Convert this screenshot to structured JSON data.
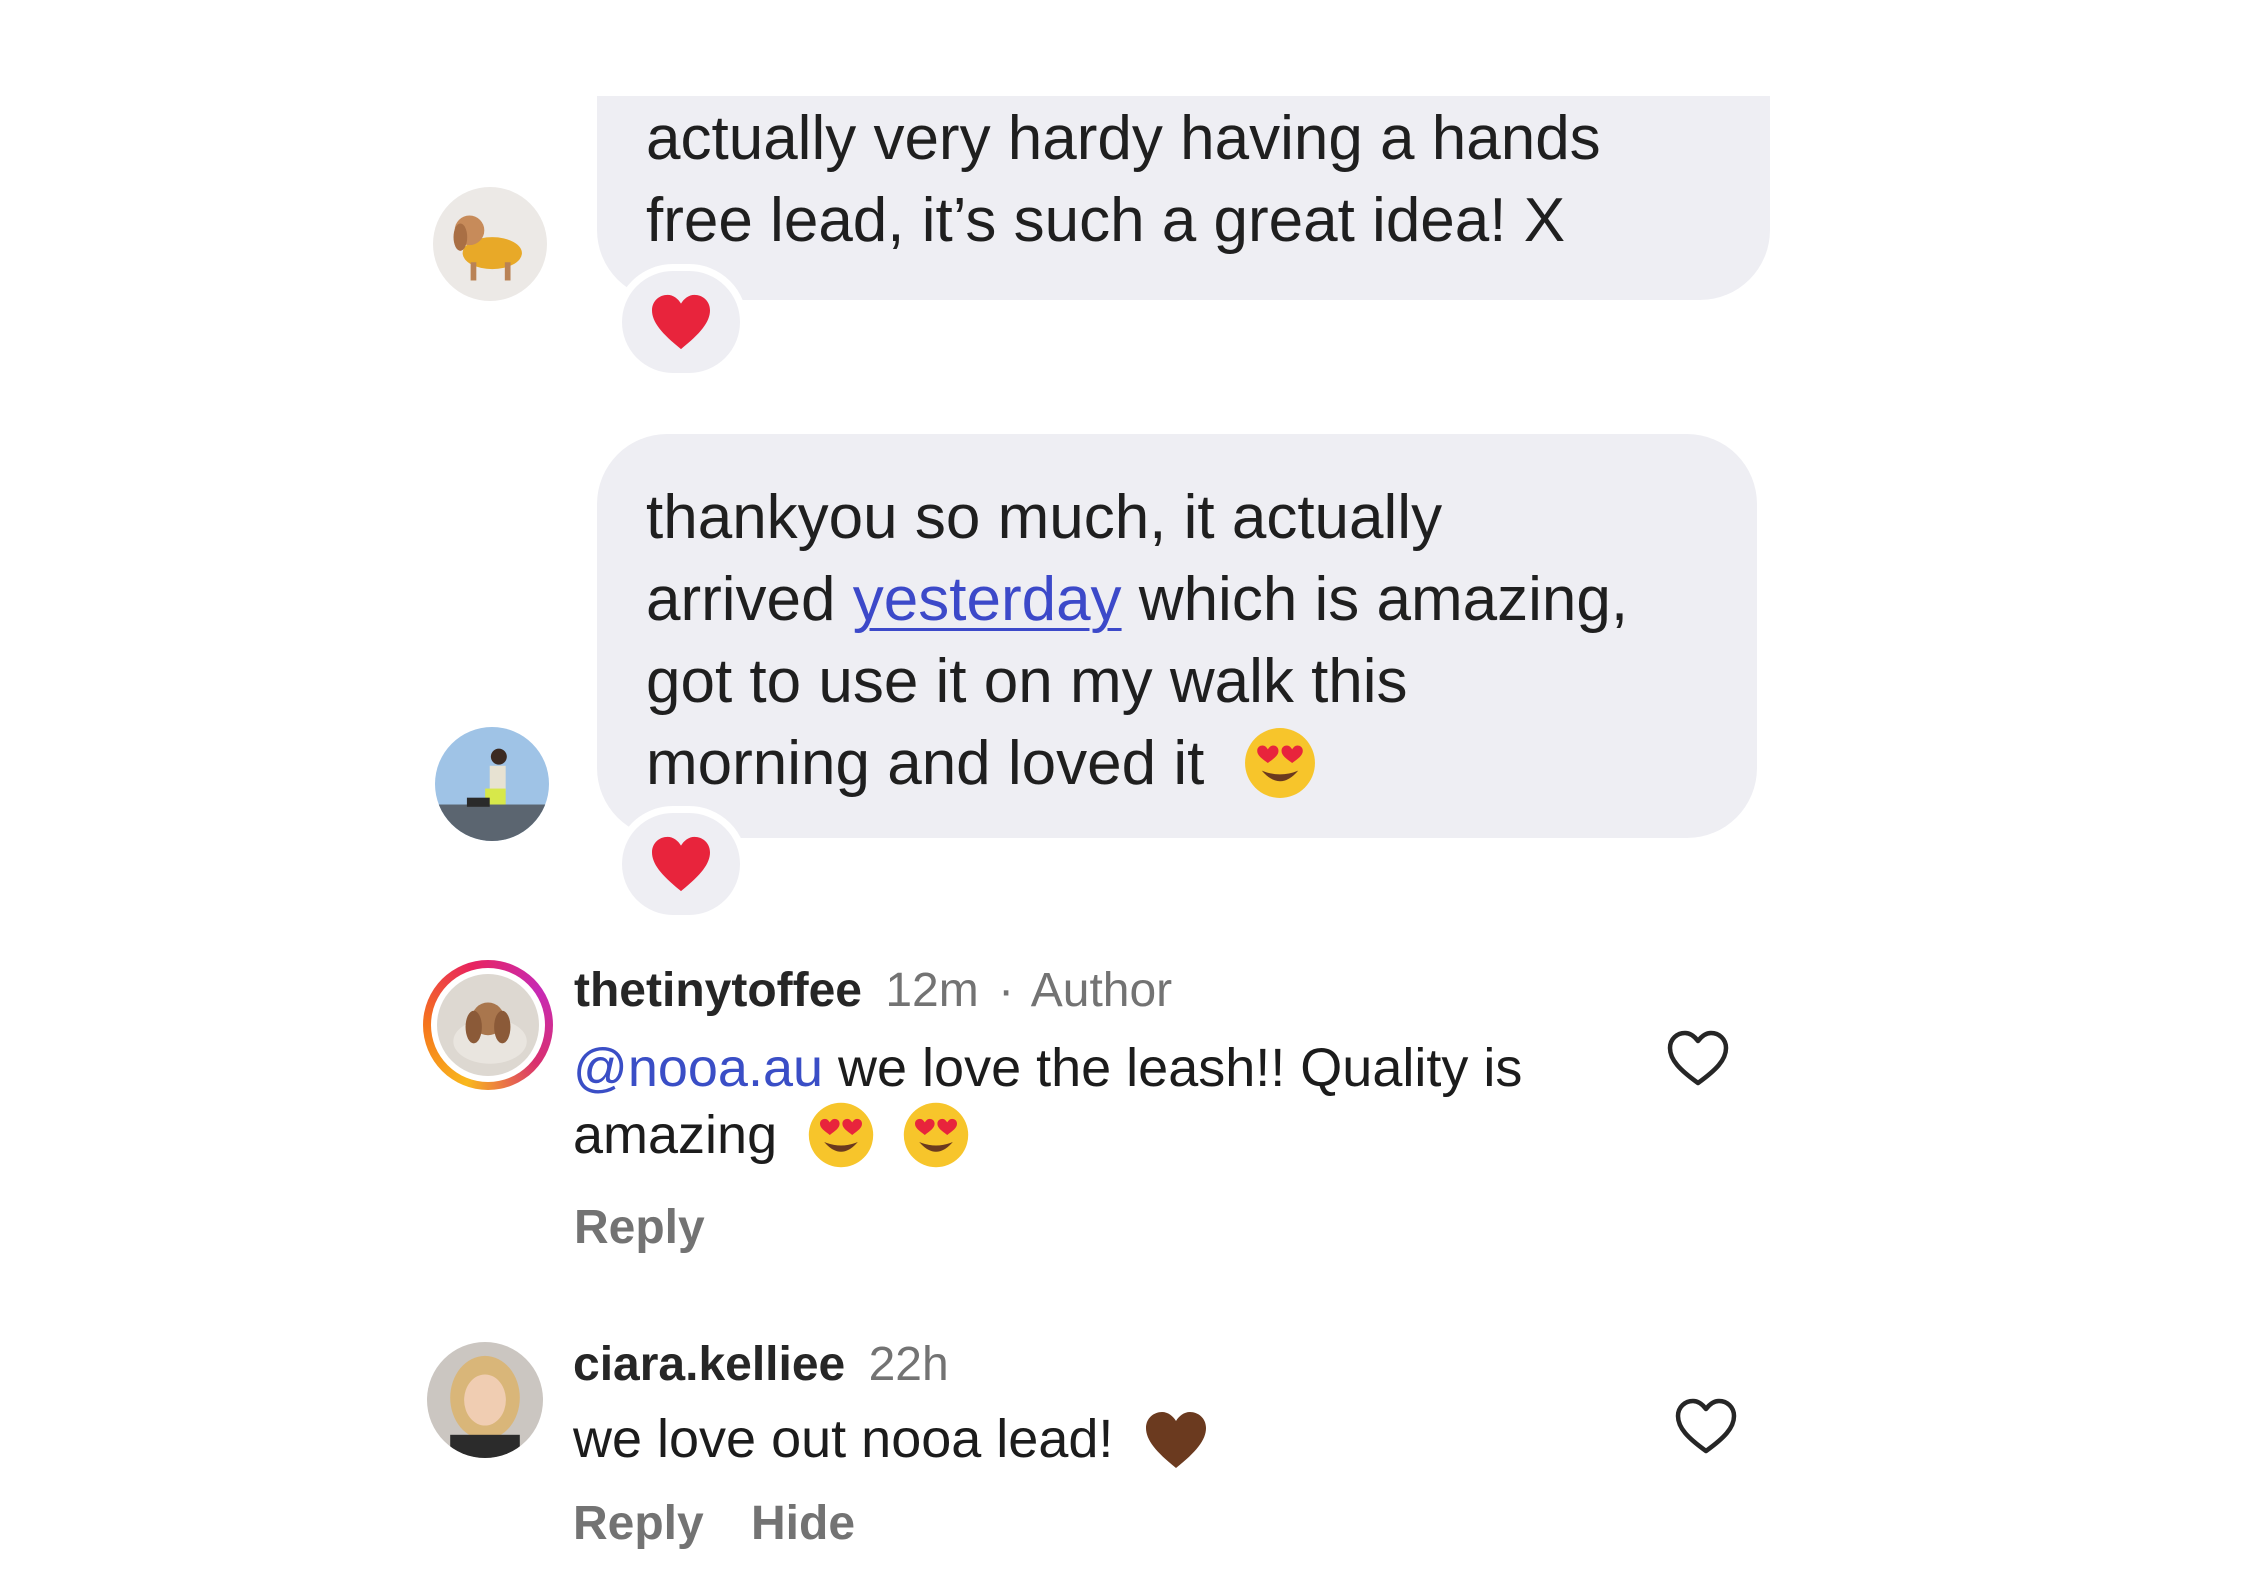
{
  "thread": {
    "message_1": {
      "line_1": "actually very hardy having a hands",
      "line_2": "free lead, it’s such a great idea! X",
      "reaction": "red-heart"
    },
    "message_2": {
      "line_1": "thankyou so much, it actually",
      "line_2_before": "arrived",
      "line_2_link": "yesterday",
      "line_2_after": "which is amazing,",
      "line_3": "got to use it on my walk this",
      "line_4": "morning and loved it",
      "line_4_emoji": "heart-eyes",
      "reaction": "red-heart"
    }
  },
  "comments": [
    {
      "username": "thetinytoffee",
      "time": "12m",
      "separator": "·",
      "badge": "Author",
      "mention": "@nooa.au",
      "text_1": " we love the leash!! Quality is",
      "text_2": "amazing",
      "emojis": [
        "heart-eyes",
        "heart-eyes"
      ],
      "actions": [
        "Reply"
      ],
      "story_ring": true
    },
    {
      "username": "ciara.kelliee",
      "time": "22h",
      "text_1": "we love out nooa lead!",
      "emojis": [
        "brown-heart"
      ],
      "actions": [
        "Reply",
        "Hide"
      ]
    }
  ],
  "colors": {
    "bubble": "#eeeef3",
    "link": "#3c49c9",
    "meta": "#737373",
    "heart": "#e8243c",
    "brown_heart": "#6b3a1f"
  }
}
